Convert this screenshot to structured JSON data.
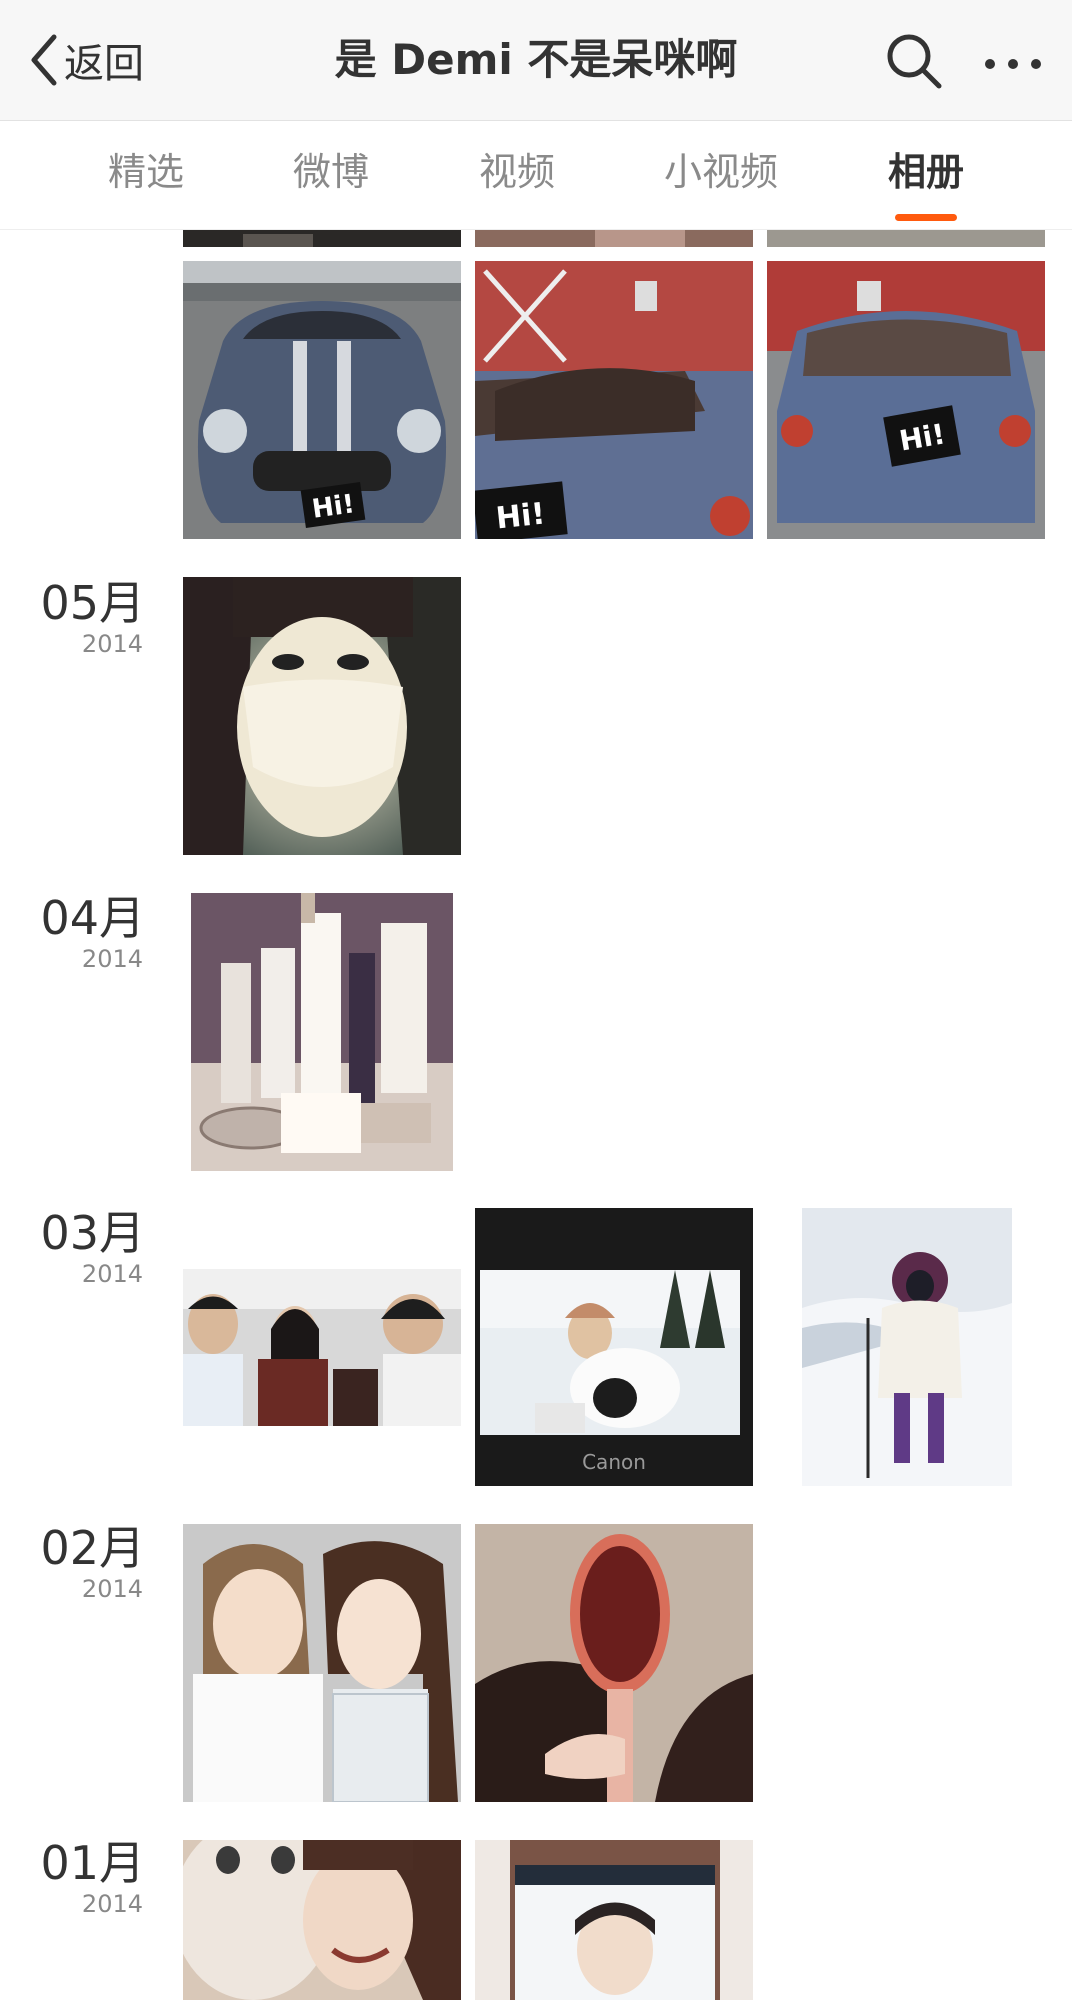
{
  "header": {
    "back_label": "返回",
    "title": "是 Demi 不是呆咪啊"
  },
  "tabs": [
    {
      "label": "精选"
    },
    {
      "label": "微博"
    },
    {
      "label": "视频"
    },
    {
      "label": "小视频"
    },
    {
      "label": "相册",
      "active": true
    }
  ],
  "accent_color": "#ff5a0e",
  "months": [
    {
      "month": "05月",
      "year": "2014"
    },
    {
      "month": "04月",
      "year": "2014"
    },
    {
      "month": "03月",
      "year": "2014"
    },
    {
      "month": "02月",
      "year": "2014"
    },
    {
      "month": "01月",
      "year": "2014"
    }
  ],
  "sticker_text": "Hi!",
  "camera_brand": "Canon"
}
